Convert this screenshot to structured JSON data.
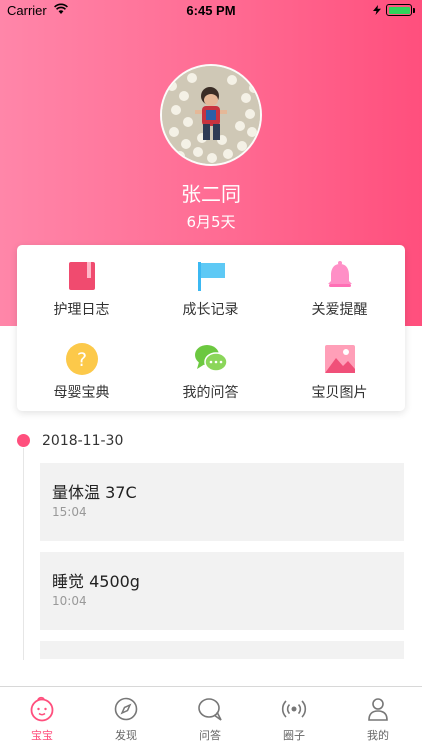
{
  "status_bar": {
    "carrier": "Carrier",
    "time": "6:45 PM"
  },
  "profile": {
    "name": "张二同",
    "age": "6月5天"
  },
  "grid": [
    {
      "label": "护理日志",
      "icon": "journal-icon"
    },
    {
      "label": "成长记录",
      "icon": "flag-icon"
    },
    {
      "label": "关爱提醒",
      "icon": "bell-icon"
    },
    {
      "label": "母婴宝典",
      "icon": "help-icon"
    },
    {
      "label": "我的问答",
      "icon": "chat-icon"
    },
    {
      "label": "宝贝图片",
      "icon": "picture-icon"
    }
  ],
  "timeline": {
    "date": "2018-11-30",
    "entries": [
      {
        "title": "量体温 37C",
        "time": "15:04"
      },
      {
        "title": "睡觉 4500g",
        "time": "10:04"
      }
    ]
  },
  "tabs": [
    {
      "label": "宝宝",
      "icon": "baby-face-icon",
      "active": true
    },
    {
      "label": "发现",
      "icon": "compass-icon",
      "active": false
    },
    {
      "label": "问答",
      "icon": "chat-bubble-icon",
      "active": false
    },
    {
      "label": "圈子",
      "icon": "broadcast-icon",
      "active": false
    },
    {
      "label": "我的",
      "icon": "person-icon",
      "active": false
    }
  ],
  "colors": {
    "accent": "#ff4f7d",
    "gradient_start": "#ff86a9",
    "gradient_end": "#ff4f7d"
  }
}
